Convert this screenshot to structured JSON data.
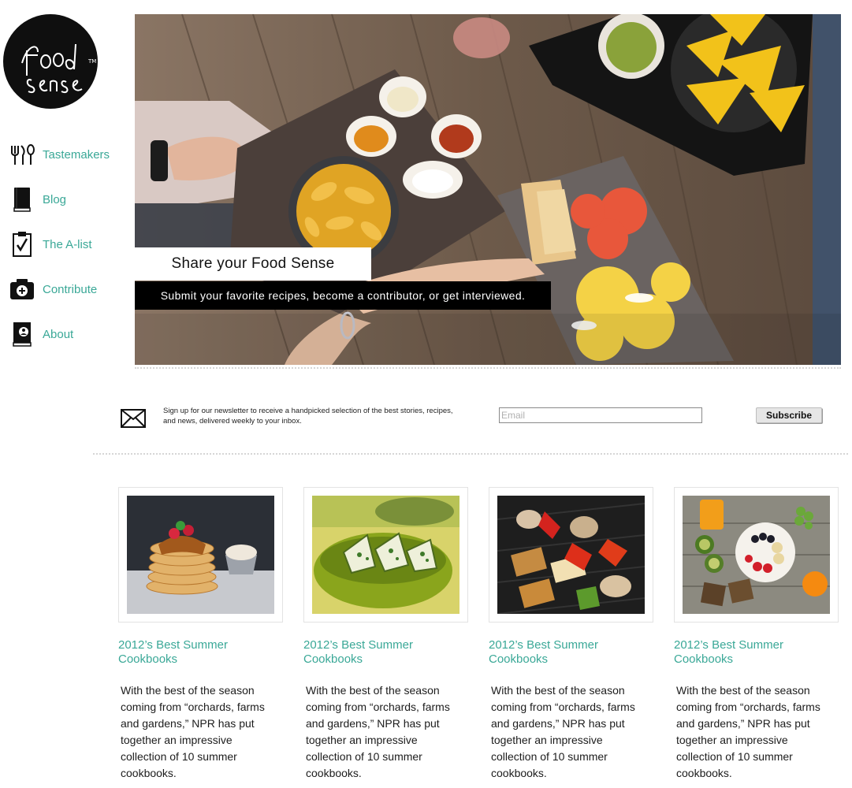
{
  "logo": {
    "line1": "food",
    "line2": "sense",
    "tm": "TM"
  },
  "nav": {
    "items": [
      {
        "label": "Tastemakers",
        "icon": "utensils-icon"
      },
      {
        "label": "Blog",
        "icon": "book-icon"
      },
      {
        "label": "The A-list",
        "icon": "clipboard-check-icon"
      },
      {
        "label": "Contribute",
        "icon": "camera-plus-icon"
      },
      {
        "label": "About",
        "icon": "profile-book-icon"
      }
    ]
  },
  "hero": {
    "title": "Share your Food Sense",
    "subtitle": "Submit your favorite recipes, become a contributor, or get interviewed."
  },
  "newsletter": {
    "text": "Sign up for our newsletter to receive a handpicked selection of the best stories, recipes, and news, delivered weekly to your inbox.",
    "email_placeholder": "Email",
    "subscribe_label": "Subscribe"
  },
  "cards": [
    {
      "image": "pancakes-image",
      "title": "2012’s Best Summer Cookbooks",
      "body": "With the best of the season coming from “orchards, farms and gardens,” NPR has put together an impressive collection of 10 summer cookbooks."
    },
    {
      "image": "green-bowl-image",
      "title": "2012’s Best Summer Cookbooks",
      "body": "With the best of the season coming from “orchards, farms and gardens,” NPR has put together an impressive collection of 10 summer cookbooks."
    },
    {
      "image": "kebabs-image",
      "title": "2012’s Best Summer Cookbooks",
      "body": "With the best of the season coming from “orchards, farms and gardens,” NPR has put together an impressive collection of 10 summer cookbooks."
    },
    {
      "image": "breakfast-table-image",
      "title": "2012’s Best Summer Cookbooks",
      "body": "With the best of the season coming from “orchards, farms and gardens,” NPR has put together an impressive collection of 10 summer cookbooks."
    }
  ],
  "colors": {
    "accent": "#3aa897",
    "dark": "#000000"
  }
}
